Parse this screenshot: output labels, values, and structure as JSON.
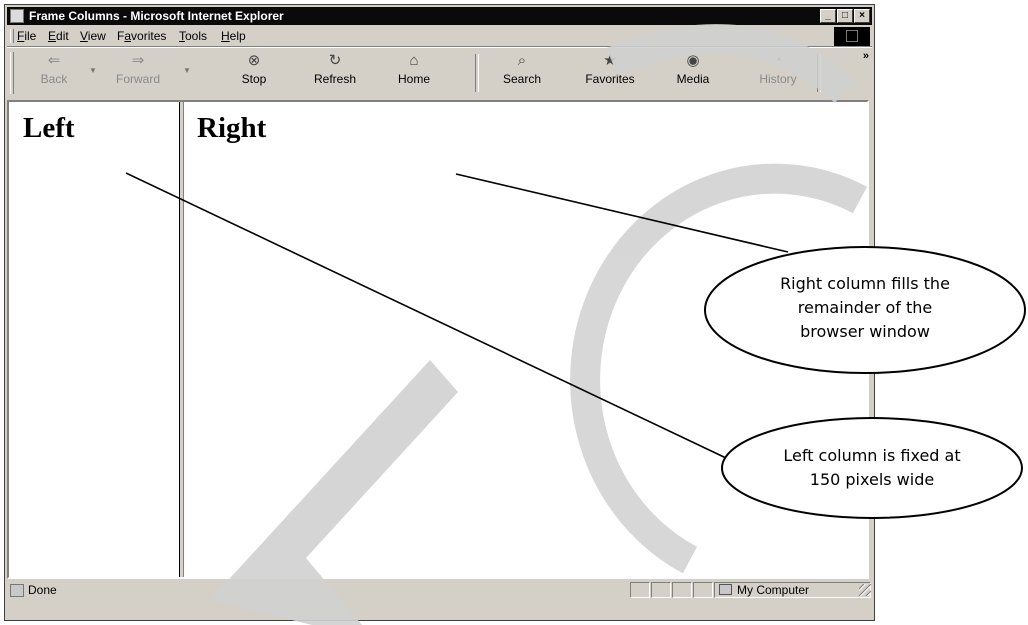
{
  "window": {
    "title": "Frame Columns - Microsoft Internet Explorer",
    "controls": {
      "minimize_icon": "minimize-icon",
      "maximize_icon": "maximize-icon",
      "close_icon": "close-icon"
    }
  },
  "menu": {
    "items": [
      {
        "label": "File",
        "accel": "F",
        "rest": "ile"
      },
      {
        "label": "Edit",
        "accel": "E",
        "rest": "dit"
      },
      {
        "label": "View",
        "accel": "V",
        "rest": "iew"
      },
      {
        "label": "Favorites",
        "accel": "a",
        "pre": "F",
        "rest": "vorites"
      },
      {
        "label": "Tools",
        "accel": "T",
        "rest": "ools"
      },
      {
        "label": "Help",
        "accel": "H",
        "rest": "elp"
      }
    ]
  },
  "toolbar": {
    "back": {
      "label": "Back",
      "icon": "back-arrow-icon"
    },
    "forward": {
      "label": "Forward",
      "icon": "forward-arrow-icon"
    },
    "stop": {
      "label": "Stop",
      "icon": "stop-icon"
    },
    "refresh": {
      "label": "Refresh",
      "icon": "refresh-icon"
    },
    "home": {
      "label": "Home",
      "icon": "home-icon"
    },
    "search": {
      "label": "Search",
      "icon": "search-icon"
    },
    "favorites": {
      "label": "Favorites",
      "icon": "favorites-icon"
    },
    "media": {
      "label": "Media",
      "icon": "media-icon"
    },
    "history": {
      "label": "History",
      "icon": "history-icon"
    },
    "more": "»"
  },
  "frames": {
    "left_heading": "Left",
    "right_heading": "Right"
  },
  "status": {
    "text": "Done",
    "zone": "My Computer"
  },
  "callouts": {
    "right_column": [
      "Right column fills the",
      "remainder of the",
      "browser window"
    ],
    "left_column": [
      "Left column is fixed at",
      "150 pixels wide"
    ]
  },
  "watermark": {
    "color": "#d0d0d0"
  }
}
